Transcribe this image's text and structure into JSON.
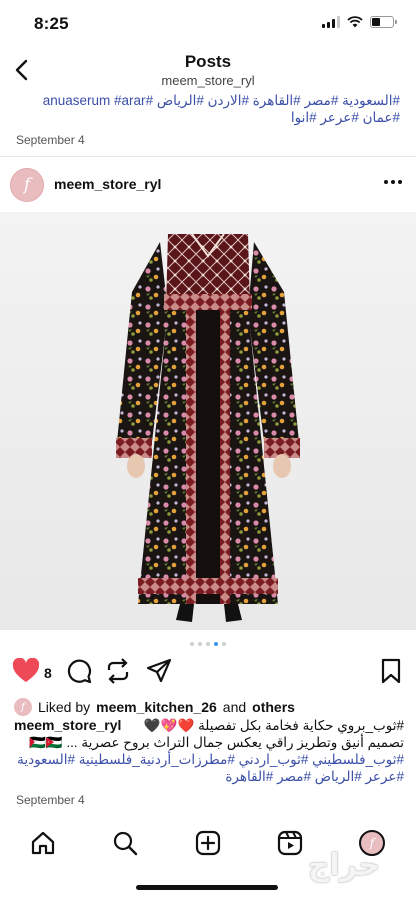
{
  "status_bar": {
    "time": "8:25",
    "battery_level": 0.4
  },
  "header": {
    "title": "Posts",
    "username": "meem_store_ryl"
  },
  "previous_post": {
    "tags_line1": "#السعودية #مصر #القاهرة #الاردن #الرياض #anuaserum #arar",
    "tags_line2": "#عمان #عرعر #انوا",
    "date": "September 4"
  },
  "post": {
    "username": "meem_store_ryl",
    "avatar_letter": "f",
    "image_alt": "embroidered dress",
    "carousel": {
      "count": 5,
      "active": 4
    },
    "likes_count": "8",
    "liked_by_prefix": "Liked by",
    "liked_by_user": "meem_kitchen_26",
    "liked_by_and": "and",
    "liked_by_others": "others",
    "caption_user": "meem_store_ryl",
    "caption_line1": "#ثوب_بروي حكاية فخامة بكل تفصيلة ❤️💖🖤",
    "caption_line2": "تصميم أنيق وتطريز راقي يعكس جمال التراث بروح عصرية ... 🇵🇸🇯🇴",
    "tags_line1": "#ثوب_فلسطيني #ثوب_اردني #مطرزات_أردنية_فلسطينية #السعودية",
    "tags_line2": "#عرعر #الرياض #مصر #القاهرة",
    "date": "September 4"
  },
  "watermark": "حراج",
  "colors": {
    "link": "#3b4fa8",
    "like_red": "#ed4956",
    "carousel_active": "#3897f0"
  },
  "icons": [
    "back-icon",
    "more-icon",
    "heart-icon",
    "comment-icon",
    "repost-icon",
    "share-icon",
    "save-icon",
    "home-icon",
    "search-icon",
    "create-icon",
    "reels-icon",
    "profile-icon"
  ]
}
